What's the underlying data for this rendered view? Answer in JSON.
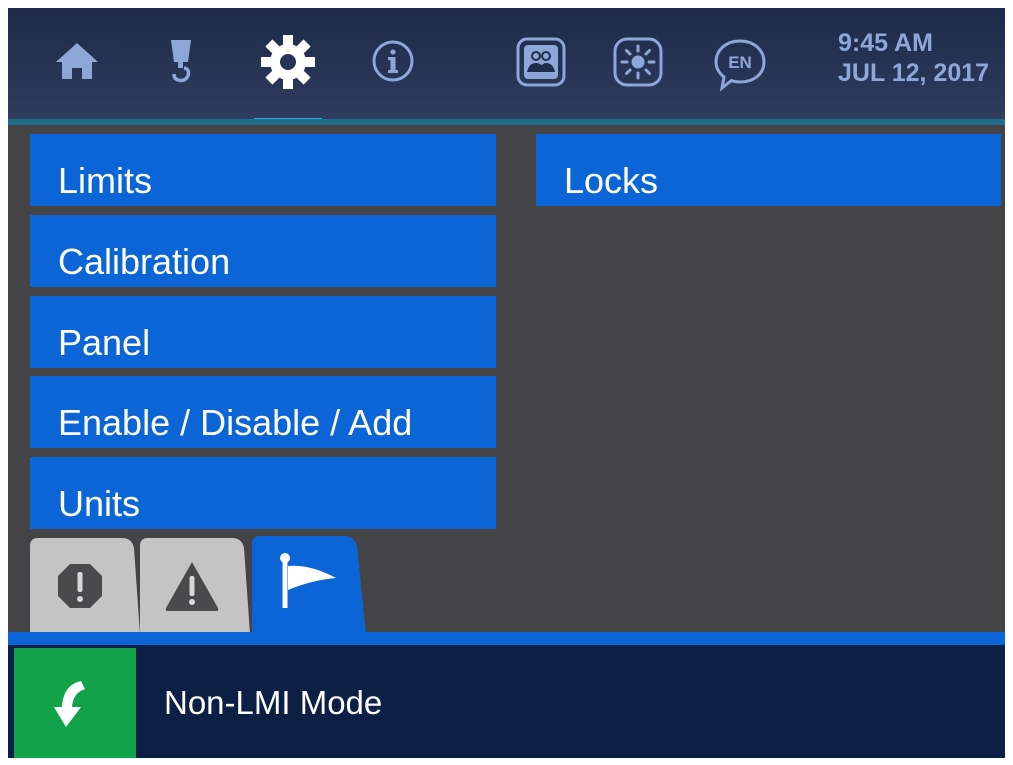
{
  "header": {
    "nav": [
      {
        "name": "home",
        "icon": "home-icon"
      },
      {
        "name": "boom",
        "icon": "hook-icon"
      },
      {
        "name": "settings",
        "icon": "gear-icon",
        "active": true
      },
      {
        "name": "info",
        "icon": "info-icon"
      }
    ],
    "quick_actions": [
      {
        "name": "users",
        "icon": "users-icon"
      },
      {
        "name": "brightness",
        "icon": "sun-icon"
      },
      {
        "name": "language",
        "icon": "language-bubble-icon",
        "label": "EN"
      }
    ],
    "time": "9:45 AM",
    "date": "JUL 12, 2017"
  },
  "menu": {
    "left_items": [
      "Limits",
      "Calibration",
      "Panel",
      "Enable / Disable / Add",
      "Units"
    ],
    "right_items": [
      "Locks"
    ]
  },
  "tabs": [
    {
      "name": "alarms",
      "icon": "octagon-exclamation-icon",
      "active": false
    },
    {
      "name": "warnings",
      "icon": "triangle-warning-icon",
      "active": false
    },
    {
      "name": "flags",
      "icon": "flag-icon",
      "active": true
    }
  ],
  "status": {
    "icon": "curved-arrow-icon",
    "text": "Non-LMI Mode"
  },
  "colors": {
    "accent": "#0b65d6",
    "active_underline": "#29a9e6",
    "status_green": "#12a24a",
    "background": "#444446",
    "header": "#2f3c5e"
  }
}
